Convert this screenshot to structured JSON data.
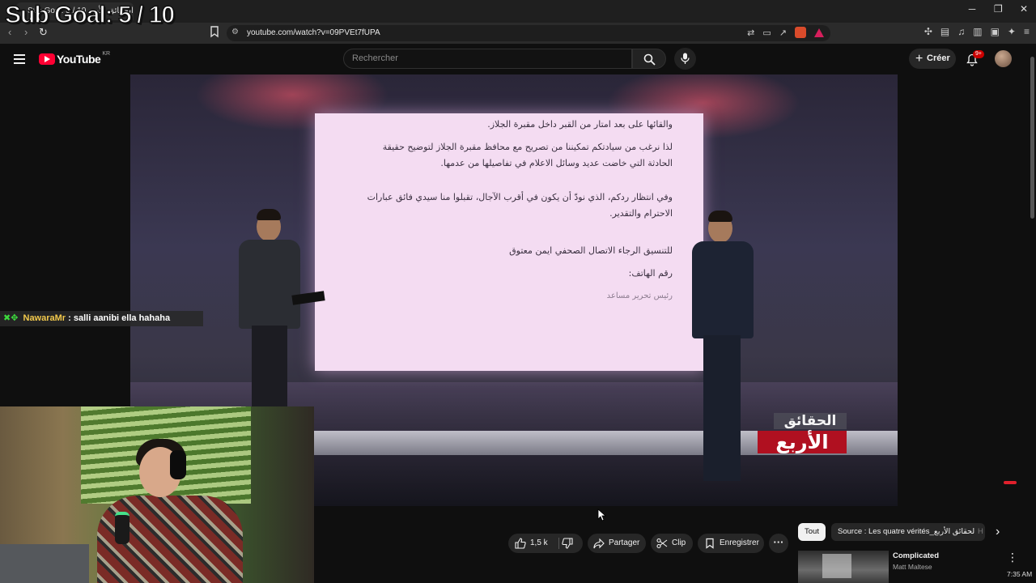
{
  "browser": {
    "tab_title": "Sub Goal: 5 / 10 الحقائق الأربع",
    "tab_close": "×",
    "url": "youtube.com/watch?v=09PVEt7fUPA",
    "window_controls": [
      "─",
      "❐",
      "✕"
    ]
  },
  "overlay": {
    "sub_goal": "Sub Goal: 5 / 10"
  },
  "youtube": {
    "logo_text": "YouTube",
    "region": "KR",
    "search_placeholder": "Rechercher",
    "create_label": "Créer",
    "notification_badge": "9+"
  },
  "video": {
    "doc_lines": [
      "والقائها على بعد امتار من القبر داخل مقبرة الجلاز.",
      "لذا نرغب من سيادتكم تمكيننا من تصريح مع محافظ مقبرة الجلاز لتوضيح حقيقة الحادثة التي خاضت عديد وسائل الاعلام في تفاصيلها من عدمها.",
      "وفي انتظار ردكم، الذي نودّ أن يكون في أقرب الآجال، تقبلوا منا سيدي فائق عبارات الاحترام والتقدير.",
      "للتنسيق الرجاء الاتصال الصحفي ايمن معتوق",
      "رقم الهاتف:",
      "رئيس تحرير مساعد"
    ],
    "show_logo_top": "الحقائق",
    "show_logo_bottom": "الأربع"
  },
  "chat": {
    "badges": "✖✥",
    "username": "NawaraMr",
    "message": ": salli aanibi ella hahaha"
  },
  "actions": {
    "like_count": "1,5 k",
    "share_label": "Partager",
    "clip_label": "Clip",
    "save_label": "Enregistrer",
    "more_label": "···"
  },
  "chips": {
    "all": "Tout",
    "source": "Source : Les quatre vérités_الحقائق الأربع",
    "more": "H"
  },
  "recommendation": {
    "title": "Complicated",
    "channel": "Matt Maltese"
  },
  "clock": "7:35 AM"
}
